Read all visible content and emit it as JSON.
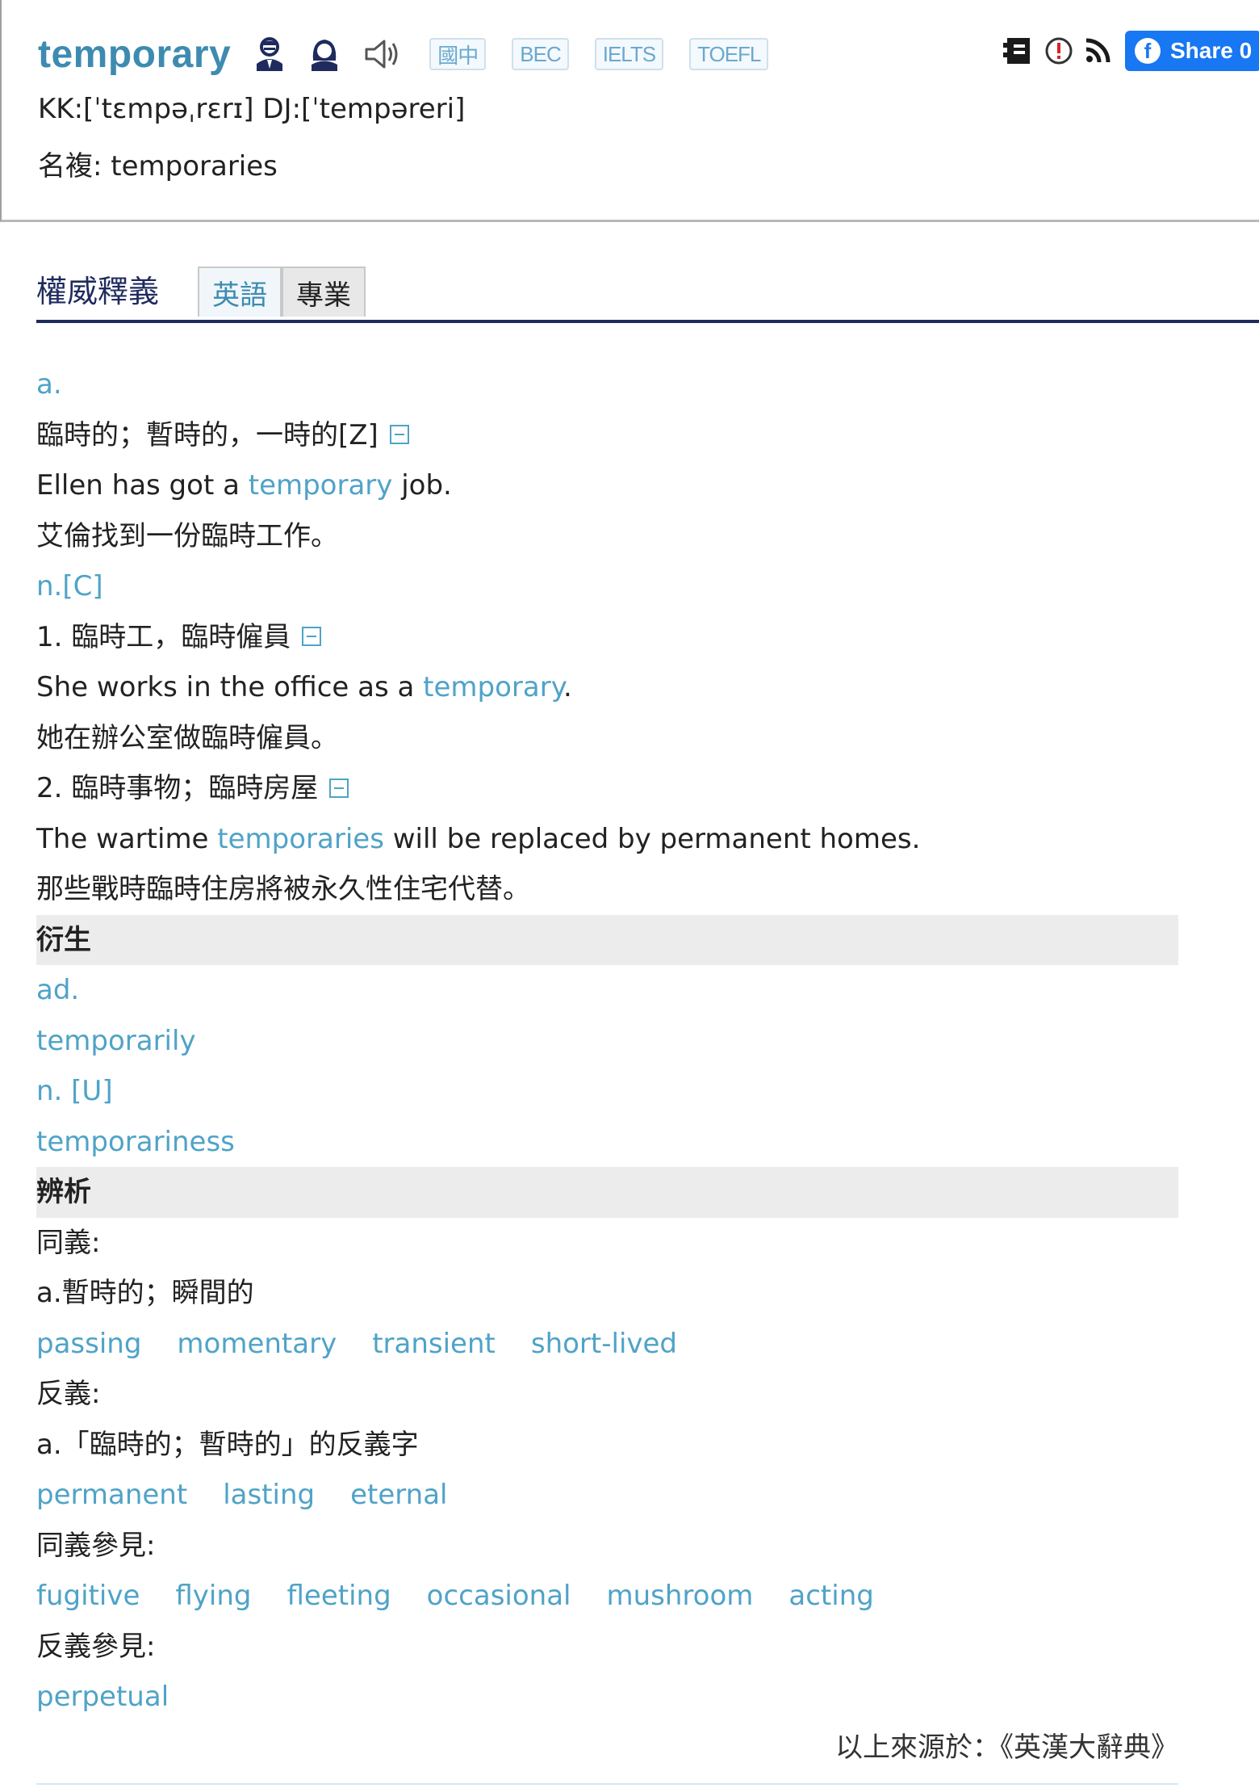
{
  "header": {
    "word": "temporary",
    "icons": [
      "male-speaker-icon",
      "female-speaker-icon",
      "speaker-icon"
    ],
    "badges": [
      "國中",
      "BEC",
      "IELTS",
      "TOEFL"
    ],
    "right_icons": [
      "wordbook-icon",
      "report-icon",
      "rss-icon"
    ],
    "share_label": "Share 0",
    "pronunciation": "KK:[ˈtɛmpəˌrɛrɪ] DJ:[ˈtempəreri]",
    "plural": "名複: temporaries"
  },
  "section": {
    "title": "權威釋義",
    "tabs": [
      "英語",
      "專業"
    ]
  },
  "entries": {
    "adj_pos": "a.",
    "adj_def": "臨時的；暫時的，一時的[Z]",
    "adj_ex_pre": "Ellen has got a ",
    "adj_ex_link": "temporary",
    "adj_ex_post": " job.",
    "adj_ex_zh": "艾倫找到一份臨時工作。",
    "noun_pos": "n.[C]",
    "noun_def1": "1. 臨時工，臨時僱員",
    "noun_ex1_pre": "She works in the office as a ",
    "noun_ex1_link": "temporary",
    "noun_ex1_post": ".",
    "noun_ex1_zh": "她在辦公室做臨時僱員。",
    "noun_def2": "2. 臨時事物；臨時房屋",
    "noun_ex2_pre": "The wartime ",
    "noun_ex2_link": "temporaries",
    "noun_ex2_post": " will be replaced by permanent homes.",
    "noun_ex2_zh": "那些戰時臨時住房將被永久性住宅代替。"
  },
  "derivatives": {
    "heading": "衍生",
    "adv_pos": "ad.",
    "adv_word": "temporarily",
    "noun_pos": "n. [U]",
    "noun_word": "temporariness"
  },
  "analysis": {
    "heading": "辨析",
    "syn_label": "同義:",
    "syn_sense": "a.暫時的；瞬間的",
    "synonyms": [
      "passing",
      "momentary",
      "transient",
      "short-lived"
    ],
    "ant_label": "反義:",
    "ant_sense": "a.「臨時的；暫時的」的反義字",
    "antonyms": [
      "permanent",
      "lasting",
      "eternal"
    ],
    "syn_ref_label": "同義參見:",
    "syn_refs": [
      "fugitive",
      "flying",
      "fleeting",
      "occasional",
      "mushroom",
      "acting"
    ],
    "ant_ref_label": "反義參見:",
    "ant_refs": [
      "perpetual"
    ]
  },
  "source": "以上來源於：《英漢大辭典》"
}
